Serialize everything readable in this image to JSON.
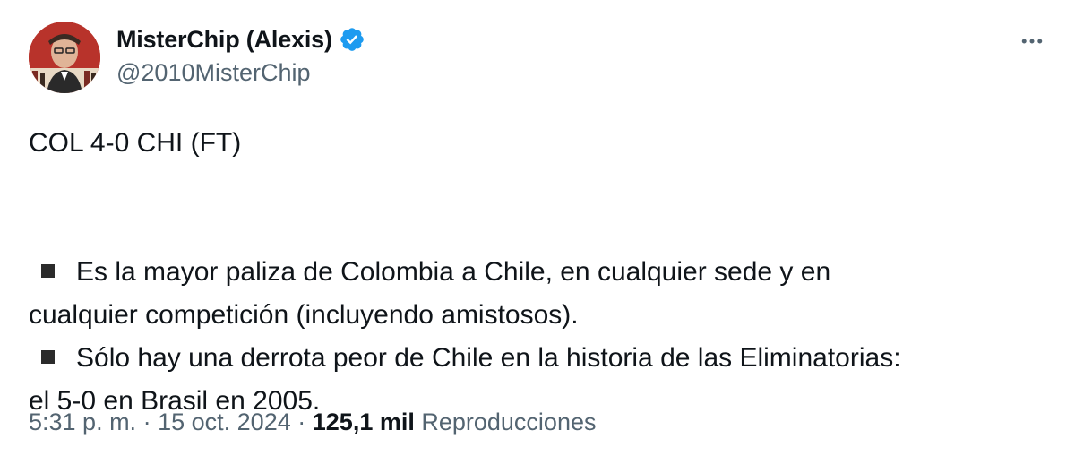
{
  "author": {
    "display_name": "MisterChip (Alexis)",
    "handle": "@2010MisterChip",
    "verified": true
  },
  "tweet": {
    "headline": "COL 4-0 CHI (FT)",
    "points": [
      {
        "line1": "Es la mayor paliza de Colombia a Chile, en cualquier sede y en",
        "line2": "cualquier competición (incluyendo amistosos)."
      },
      {
        "line1": "Sólo hay una derrota peor de Chile en la historia de las Eliminatorias:",
        "line2": "el 5-0 en Brasil en 2005."
      }
    ]
  },
  "meta": {
    "time": "5:31 p. m.",
    "separator": "·",
    "date": "15 oct. 2024",
    "views_count": "125,1 mil",
    "views_label": "Reproducciones"
  },
  "icons": {
    "verified": "verified-badge-icon",
    "more": "more-options-icon",
    "bullet": "black-square-bullet-icon"
  },
  "colors": {
    "text": "#0f1419",
    "secondary": "#536471",
    "verified": "#1d9bf0"
  }
}
